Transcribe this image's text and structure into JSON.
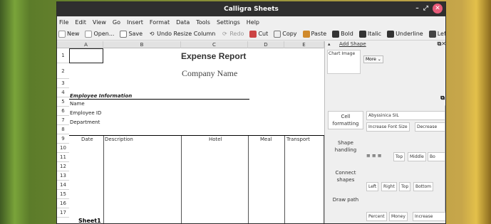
{
  "app": {
    "title": "Calligra Sheets"
  },
  "menu": [
    "File",
    "Edit",
    "View",
    "Go",
    "Insert",
    "Format",
    "Data",
    "Tools",
    "Settings",
    "Help"
  ],
  "toolbar": {
    "new_label": "New",
    "open_label": "Open...",
    "save_label": "Save",
    "undo_label": "Undo Resize Column",
    "redo_label": "Redo",
    "cut_label": "Cut",
    "copy_label": "Copy",
    "paste_label": "Paste",
    "bold_label": "Bold",
    "italic_label": "Italic",
    "underline_label": "Underline",
    "left_label": "Left"
  },
  "columns": [
    "A",
    "B",
    "C",
    "D",
    "E"
  ],
  "rows": [
    "1",
    "2",
    "3",
    "4",
    "5",
    "6",
    "7",
    "8",
    "9",
    "10",
    "11",
    "12",
    "13",
    "14",
    "15",
    "16",
    "17"
  ],
  "sheet": {
    "title": "Expense Report",
    "company": "Company Name",
    "section": "Employee Information",
    "fields": [
      "Name",
      "Employee ID",
      "Department"
    ],
    "table_headers": [
      "Date",
      "Description",
      "Hotel",
      "Meal",
      "Transport"
    ]
  },
  "sheet_tab": "Sheet1",
  "panel": {
    "add_shape": "Add Shape",
    "chart_image": "Chart Image",
    "more": "More",
    "tabs": [
      "Cell formatting",
      "Shape handling",
      "Connect shapes",
      "Draw path"
    ],
    "font_name": "Abyssinica SIL",
    "increase_font": "Increase Font Size",
    "decrease_font": "Decrease",
    "valign": [
      "Top",
      "Middle",
      "Bo"
    ],
    "halign": [
      "Left",
      "Right",
      "Top",
      "Bottom"
    ],
    "formats": [
      "Percent",
      "Money",
      "Increase"
    ]
  }
}
